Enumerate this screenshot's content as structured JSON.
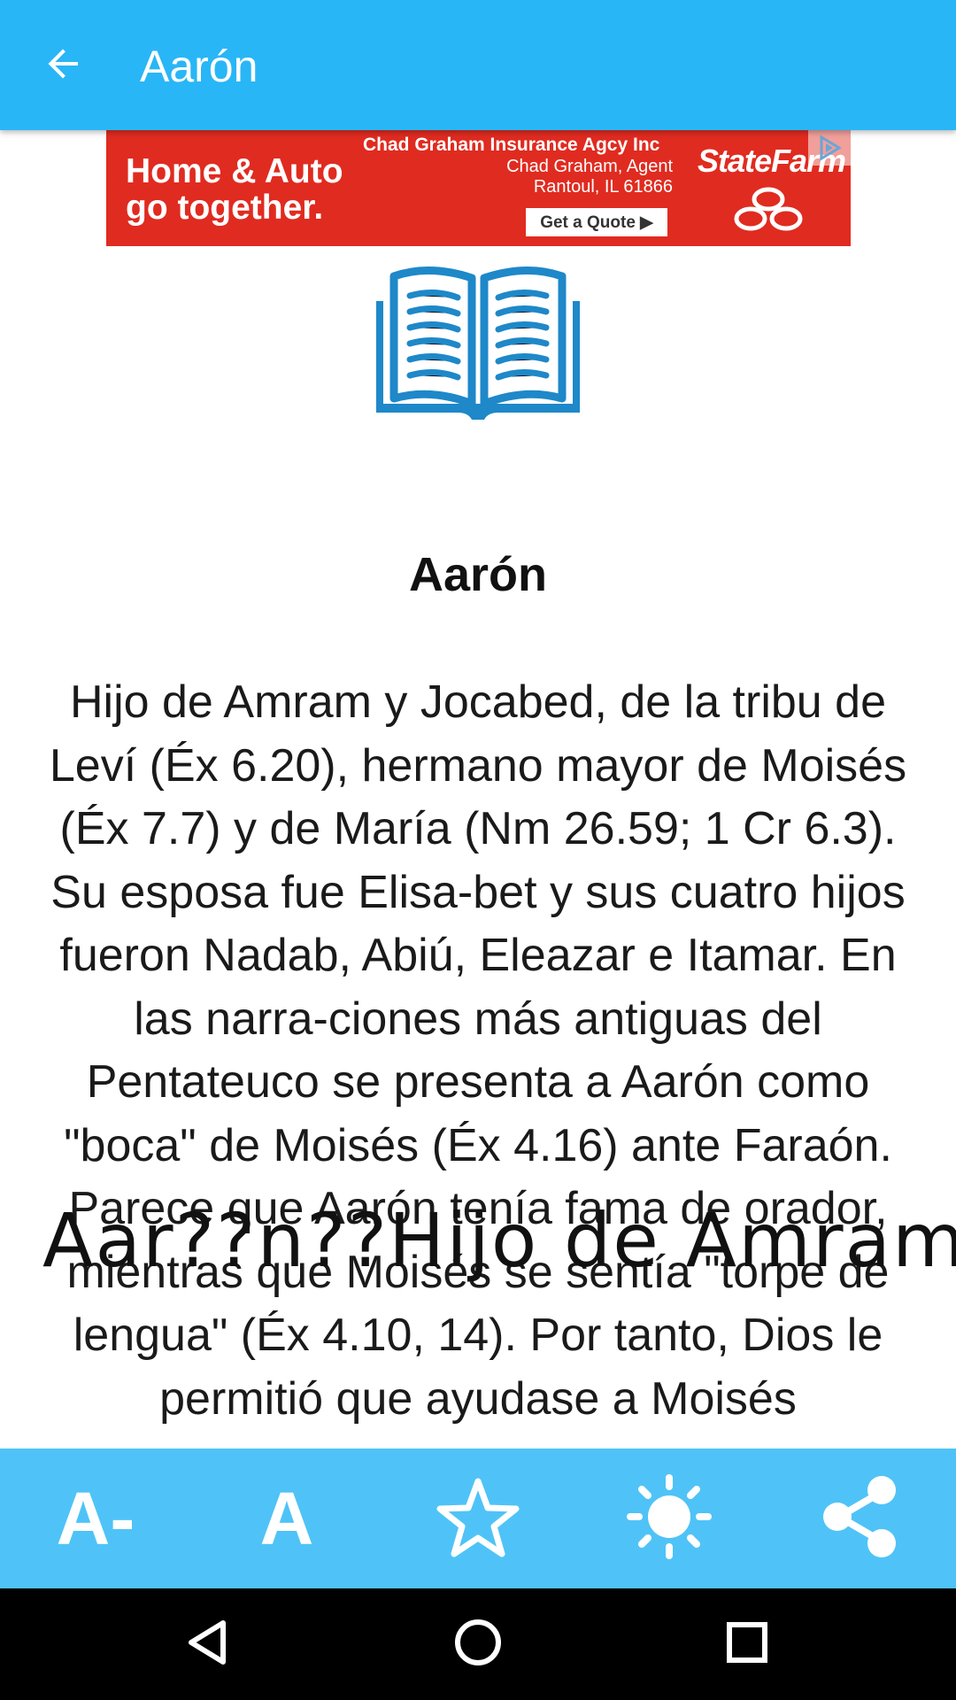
{
  "appbar": {
    "title": "Aarón",
    "back_icon": "arrow-back-icon",
    "color": "#29b6f6"
  },
  "ad": {
    "headline": "Home & Auto go together.",
    "agency": "Chad Graham Insurance Agcy Inc",
    "agent_line1": "Chad Graham, Agent",
    "agent_line2": "Rantoul, IL 61866",
    "cta": "Get a Quote ▶",
    "brand": "StateFarm",
    "color": "#e02b20"
  },
  "article": {
    "icon": "open-book-icon",
    "icon_color": "#1e88c9",
    "title": "Aarón",
    "body": "Hijo de Amram y Jocabed, de la tribu de Leví (Éx 6.20), hermano mayor de Moisés (Éx 7.7) y de María (Nm 26.59; 1 Cr 6.3). Su esposa fue Elisa-bet y sus cuatro hijos fueron Nadab, Abiú, Eleazar e Itamar. En las narra-ciones más antiguas del Pentateuco se presenta a Aarón como \"boca\" de Moisés (Éx 4.16) ante Faraón. Parece que Aarón tenía fama de orador, mientras que Moisés se sentía \"torpe de lengua\" (Éx 4.10, 14). Por tanto, Dios le permitió que ayudase a Moisés",
    "overlay": "Aar??n??Hijo  de  Amram"
  },
  "toolbar": {
    "color": "#4fc3f7",
    "decrease_label": "A-",
    "font_label": "A",
    "favorite_icon": "star-outline-icon",
    "brightness_icon": "sun-icon",
    "share_icon": "share-icon"
  },
  "navbar": {
    "back_icon": "nav-back-icon",
    "home_icon": "nav-home-icon",
    "recents_icon": "nav-recents-icon"
  }
}
